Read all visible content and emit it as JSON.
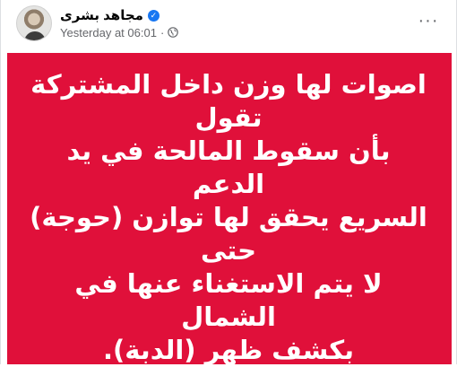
{
  "author": {
    "name": "مجاهد بشرى",
    "verified_icon": "verified-badge-icon"
  },
  "meta": {
    "timestamp": "Yesterday at 06:01",
    "separator": "·",
    "privacy_icon": "globe-icon"
  },
  "more_menu": {
    "label": "···",
    "icon": "more-options-icon"
  },
  "post": {
    "background_color": "#e0103a",
    "text_color": "#ffffff",
    "text": "اصوات لها وزن داخل المشتركة تقول\nبأن سقوط المالحة في يد الدعم\nالسريع يحقق لها توازن (حوجة) حتى\nلا يتم الاستغناء عنها في الشمال\nبكشف ظهر (الدبة)."
  },
  "colors": {
    "accent_blue": "#1877f2",
    "secondary_text": "#65676b",
    "primary_text": "#050505"
  }
}
